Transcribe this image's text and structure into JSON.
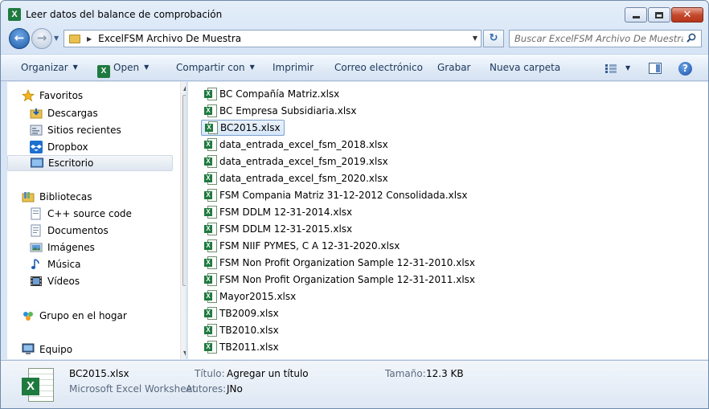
{
  "window": {
    "title": "Leer datos del balance de comprobación",
    "app_icon_letter": "X"
  },
  "address": {
    "breadcrumb": "ExcelFSM Archivo De Muestra",
    "search_placeholder": "Buscar ExcelFSM Archivo De Muestra"
  },
  "toolbar": {
    "organize": "Organizar",
    "open": "Open",
    "share": "Compartir con",
    "print": "Imprimir",
    "email": "Correo electrónico",
    "burn": "Grabar",
    "new_folder": "Nueva carpeta"
  },
  "nav": {
    "favorites": "Favoritos",
    "downloads": "Descargas",
    "recent": "Sitios recientes",
    "dropbox": "Dropbox",
    "desktop": "Escritorio",
    "libraries": "Bibliotecas",
    "cpp": "C++ source code",
    "documents": "Documentos",
    "images": "Imágenes",
    "music": "Música",
    "videos": "Vídeos",
    "homegroup": "Grupo en el hogar",
    "computer": "Equipo"
  },
  "files": [
    "BC Compañía Matriz.xlsx",
    "BC Empresa Subsidiaria.xlsx",
    "BC2015.xlsx",
    "data_entrada_excel_fsm_2018.xlsx",
    "data_entrada_excel_fsm_2019.xlsx",
    "data_entrada_excel_fsm_2020.xlsx",
    "FSM Compania Matriz 31-12-2012 Consolidada.xlsx",
    "FSM DDLM 12-31-2014.xlsx",
    "FSM DDLM 12-31-2015.xlsx",
    "FSM NIIF PYMES, C A  12-31-2020.xlsx",
    "FSM Non Profit Organization Sample 12-31-2010.xlsx",
    "FSM Non Profit Organization Sample 12-31-2011.xlsx",
    "Mayor2015.xlsx",
    "TB2009.xlsx",
    "TB2010.xlsx",
    "TB2011.xlsx"
  ],
  "details": {
    "name": "BC2015.xlsx",
    "type": "Microsoft Excel Worksheet",
    "title_label": "Título:",
    "title_value": "Agregar un título",
    "authors_label": "Autores:",
    "authors_value": "JNo",
    "size_label": "Tamaño:",
    "size_value": "12.3 KB"
  }
}
